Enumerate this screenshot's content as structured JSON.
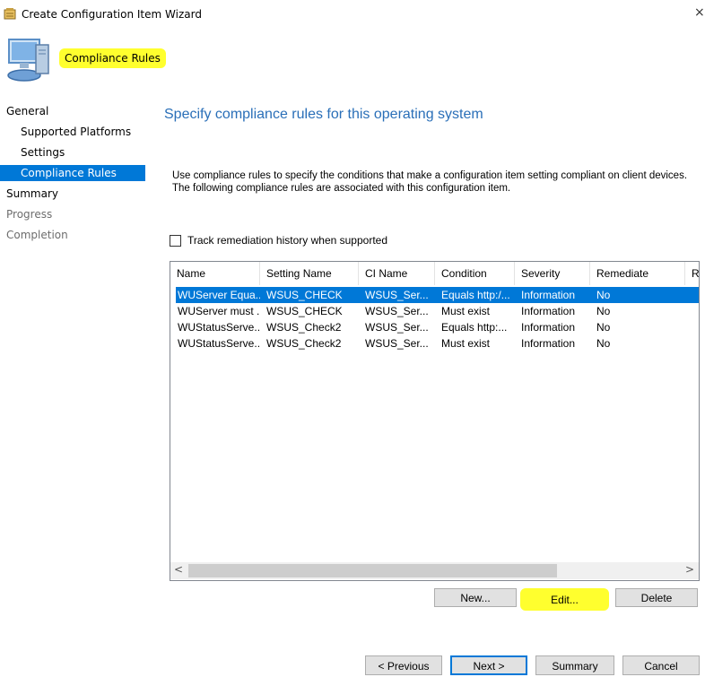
{
  "window": {
    "title": "Create Configuration Item Wizard",
    "close_glyph": "×"
  },
  "header": {
    "title": "Compliance Rules",
    "highlight_color": "#ffff2e"
  },
  "nav": {
    "items": [
      {
        "label": "General"
      },
      {
        "label": "Supported Platforms"
      },
      {
        "label": "Settings"
      },
      {
        "label": "Compliance Rules"
      },
      {
        "label": "Summary"
      },
      {
        "label": "Progress"
      },
      {
        "label": "Completion"
      }
    ],
    "active_color": "#0078d7"
  },
  "page": {
    "heading": "Specify compliance rules for this operating system",
    "description": "Use compliance rules to specify the conditions that make a configuration item setting compliant on client devices. The following compliance rules are associated with this configuration item.",
    "track_label": "Track remediation history when supported"
  },
  "grid": {
    "columns": [
      "Name",
      "Setting Name",
      "CI Name",
      "Condition",
      "Severity",
      "Remediate",
      "R"
    ],
    "rows": [
      [
        "WUServer Equa...",
        "WSUS_CHECK",
        "WSUS_Ser...",
        "Equals http:/...",
        "Information",
        "No"
      ],
      [
        "WUServer must ...",
        "WSUS_CHECK",
        "WSUS_Ser...",
        "Must exist",
        "Information",
        "No"
      ],
      [
        "WUStatusServe...",
        "WSUS_Check2",
        "WSUS_Ser...",
        "Equals http:...",
        "Information",
        "No"
      ],
      [
        "WUStatusServe...",
        "WSUS_Check2",
        "WSUS_Ser...",
        "Must exist",
        "Information",
        "No"
      ]
    ],
    "scroll_left": "<",
    "scroll_right": ">"
  },
  "rule_buttons": {
    "new": "New...",
    "edit": "Edit...",
    "delete": "Delete"
  },
  "footer": {
    "previous": "< Previous",
    "next": "Next >",
    "summary": "Summary",
    "cancel": "Cancel"
  }
}
